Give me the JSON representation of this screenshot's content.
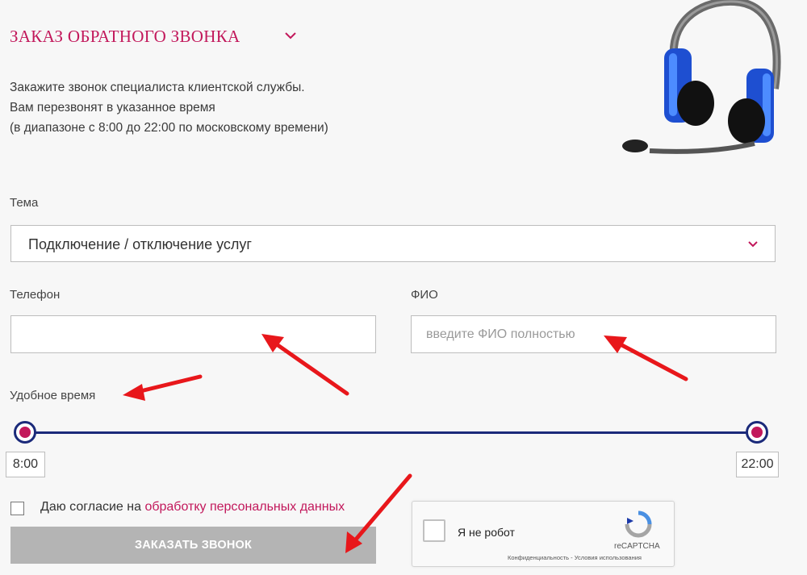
{
  "header": {
    "title": "ЗАКАЗ ОБРАТНОГО ЗВОНКА",
    "chevron_icon": "chevron-down-icon"
  },
  "description": [
    "Закажите звонок специалиста клиентской службы.",
    "Вам перезвонят в указанное время",
    "(в диапазоне с 8:00 до 22:00 по московскому времени)"
  ],
  "form": {
    "topic": {
      "label": "Тема",
      "value": "Подключение / отключение услуг"
    },
    "phone": {
      "label": "Телефон",
      "value": "",
      "placeholder": ""
    },
    "fio": {
      "label": "ФИО",
      "value": "",
      "placeholder": "введите ФИО полностью"
    },
    "time": {
      "label": "Удобное время",
      "from": "8:00",
      "to": "22:00"
    },
    "consent": {
      "text": "Даю согласие на ",
      "link": "обработку персональных данных",
      "checked": false
    },
    "submit_label": "ЗАКАЗАТЬ ЗВОНОК"
  },
  "captcha": {
    "label": "Я не робот",
    "brand": "reCAPTCHA",
    "links": "Конфиденциальность - Условия использования"
  },
  "colors": {
    "accent": "#c2185b",
    "slider": "#1b2a7a",
    "button_disabled": "#b4b4b4",
    "annotation_arrow": "#e8171b"
  }
}
